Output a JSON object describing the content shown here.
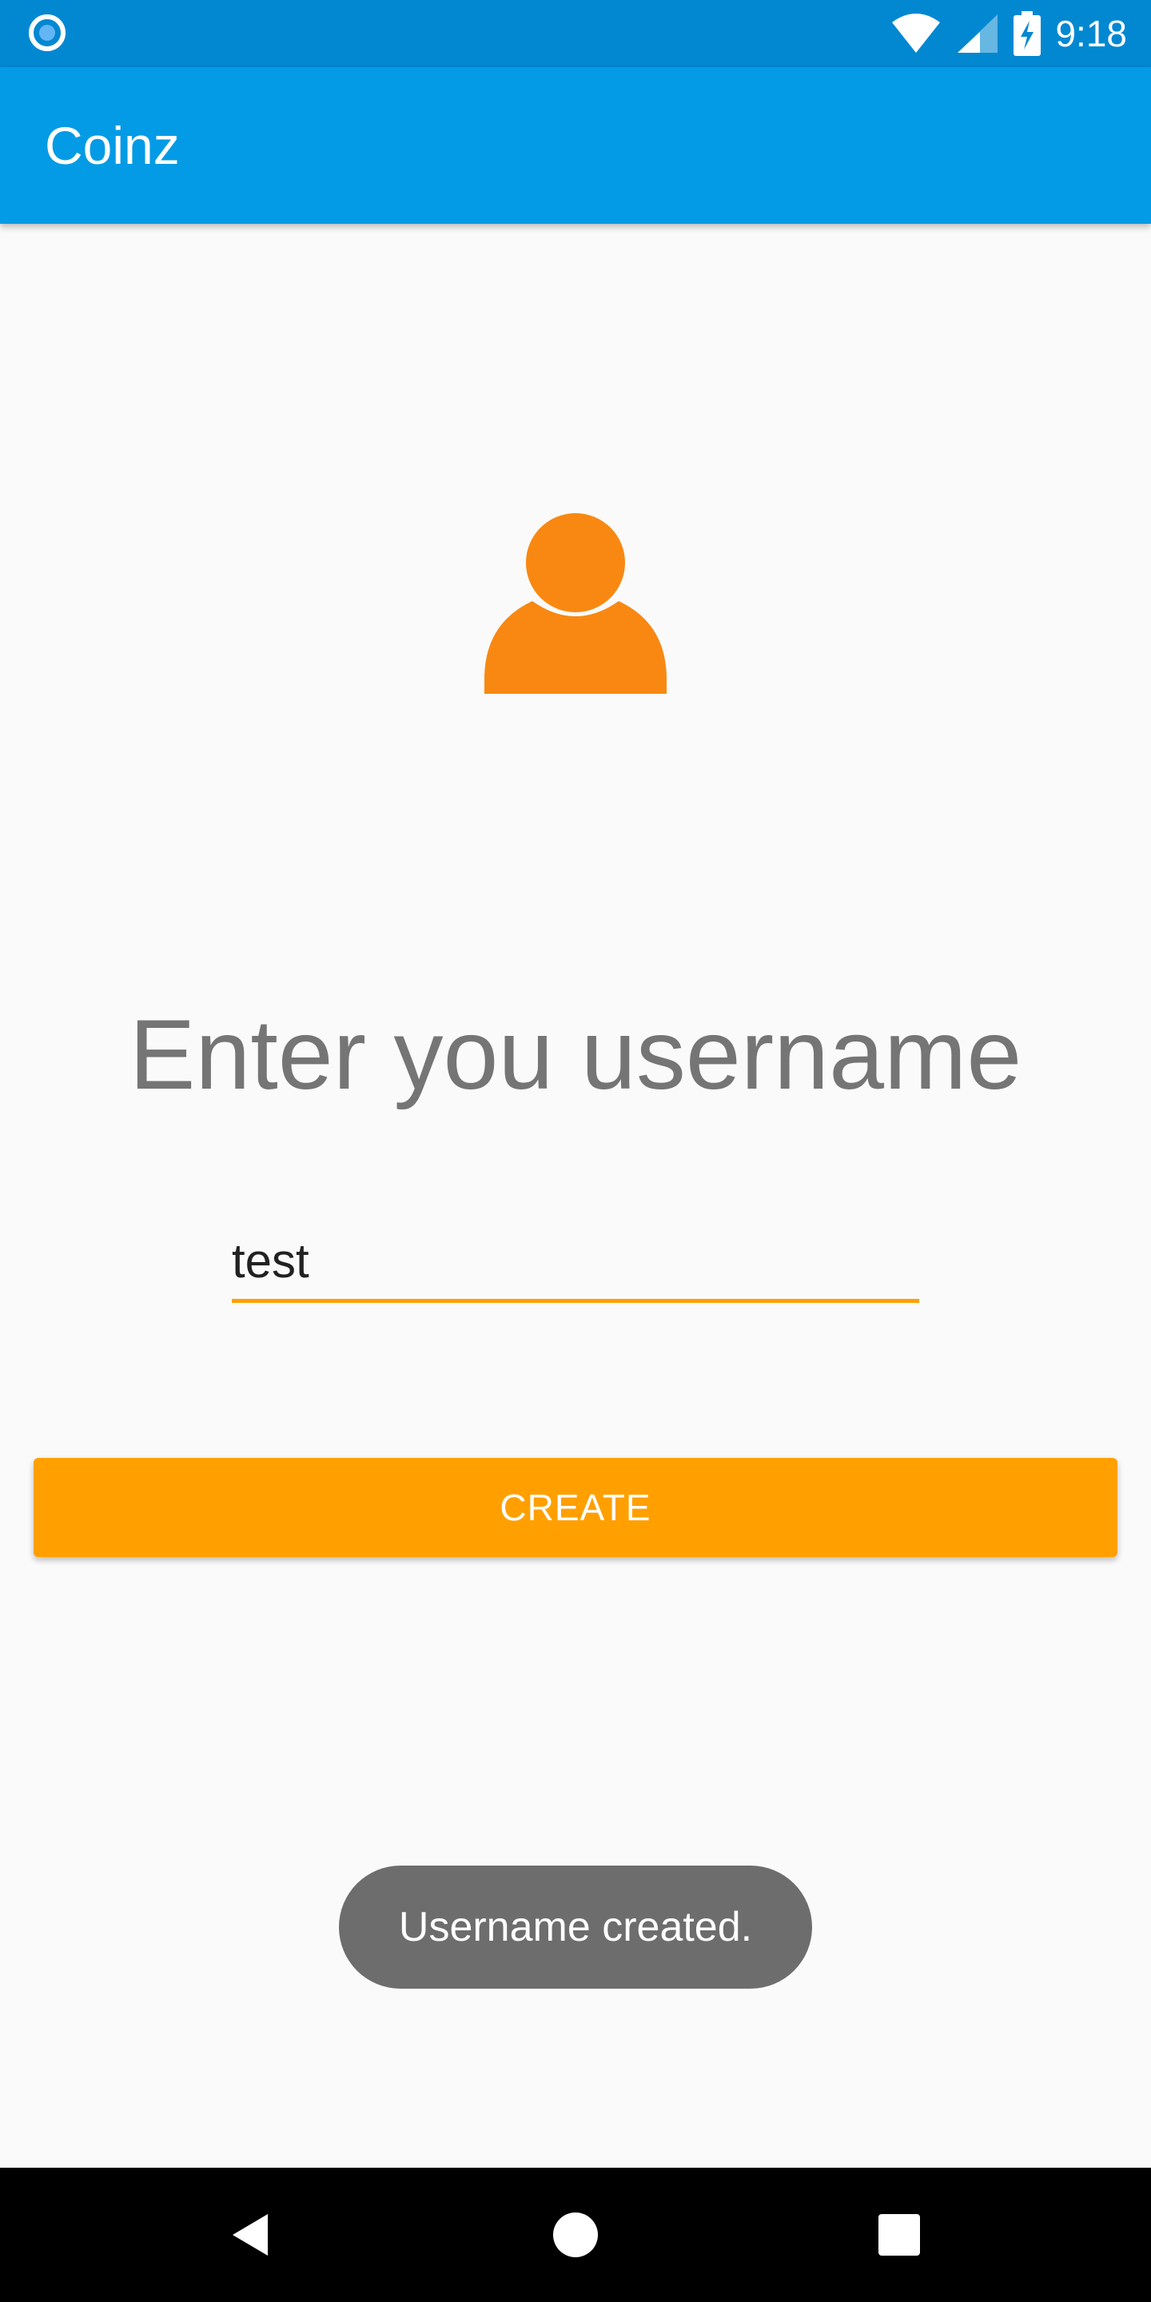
{
  "status_bar": {
    "time": "9:18",
    "icons": [
      "notification-icon",
      "wifi-icon",
      "signal-icon",
      "battery-icon"
    ]
  },
  "app_bar": {
    "title": "Coinz"
  },
  "avatar": {
    "icon": "person-icon",
    "color": "#f88812"
  },
  "form": {
    "heading": "Enter you username",
    "username_value": "test",
    "create_label": "CREATE"
  },
  "toast": {
    "message": "Username created."
  },
  "nav_bar": {
    "icons": [
      "back-icon",
      "home-icon",
      "recents-icon"
    ]
  },
  "colors": {
    "status_bar": "#0288d1",
    "app_bar": "#039be5",
    "accent": "#ffa000",
    "toast": "#6d6d6d"
  }
}
